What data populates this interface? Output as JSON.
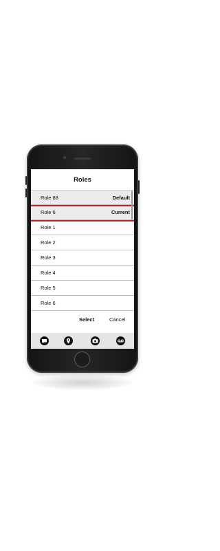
{
  "dialog": {
    "title": "Roles"
  },
  "roles": [
    {
      "label": "Role 88",
      "tag": "Default"
    },
    {
      "label": "Role 6",
      "tag": "Current"
    },
    {
      "label": "Role 1",
      "tag": ""
    },
    {
      "label": "Role 2",
      "tag": ""
    },
    {
      "label": "Role 3",
      "tag": ""
    },
    {
      "label": "Role 4",
      "tag": ""
    },
    {
      "label": "Role 5",
      "tag": ""
    },
    {
      "label": "Role 6",
      "tag": ""
    }
  ],
  "actions": {
    "select_label": "Select",
    "cancel_label": "Cancel"
  },
  "tabbar": {
    "icons": [
      "chat-bubble-icon",
      "location-pin-icon",
      "camera-icon",
      "voicemail-icon"
    ]
  },
  "colors": {
    "accent": "#b8262b",
    "selected_row": "#ececec",
    "tabbar": "#e4e4e4"
  }
}
